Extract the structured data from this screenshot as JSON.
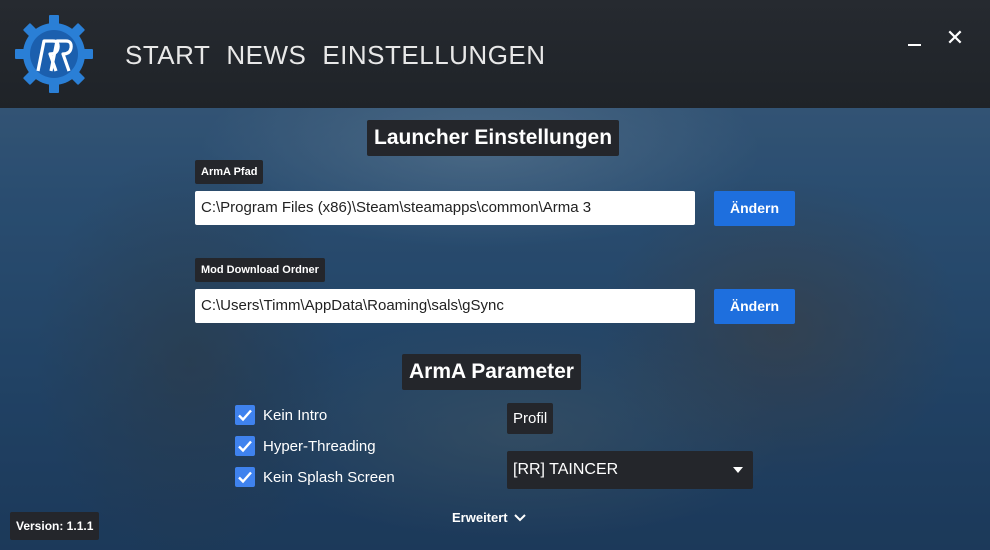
{
  "nav": {
    "items": [
      {
        "label": "START"
      },
      {
        "label": "NEWS"
      },
      {
        "label": "EINSTELLUNGEN"
      }
    ]
  },
  "window": {
    "minimize_icon": "minimize-icon",
    "close_icon": "close-icon",
    "close_glyph": "✕"
  },
  "launcher": {
    "title": "Launcher Einstellungen",
    "arma_path": {
      "label": "ArmA Pfad",
      "value": "C:\\Program Files (x86)\\Steam\\steamapps\\common\\Arma 3",
      "button": "Ändern"
    },
    "mod_folder": {
      "label": "Mod Download Ordner",
      "value": "C:\\Users\\Timm\\AppData\\Roaming\\sals\\gSync",
      "button": "Ändern"
    }
  },
  "parameters": {
    "title": "ArmA Parameter",
    "options": [
      {
        "label": "Kein Intro",
        "checked": true
      },
      {
        "label": "Hyper-Threading",
        "checked": true
      },
      {
        "label": "Kein Splash Screen",
        "checked": true
      }
    ],
    "profile": {
      "label": "Profil",
      "selected": "[RR] TAINCER"
    }
  },
  "advanced": {
    "label": "Erweitert"
  },
  "version": {
    "label": "Version: 1.1.1"
  },
  "colors": {
    "accent": "#1e6fde",
    "checkbox": "#3f82ee",
    "header": "#262a30",
    "tag_bg": "#24262b"
  }
}
